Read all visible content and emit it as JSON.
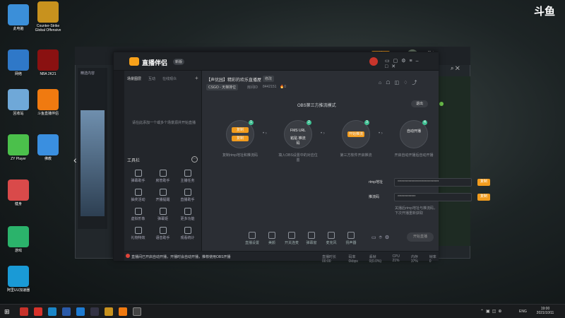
{
  "watermark": "斗鱼",
  "desktop": {
    "icons": [
      {
        "label": "此电脑",
        "color": "#3b8fd9"
      },
      {
        "label": "Counter-Strike Global Offensive",
        "color": "#c8921e"
      },
      {
        "label": "网络",
        "color": "#2f78c8"
      },
      {
        "label": "NBA 2K21",
        "color": "#8a1111"
      },
      {
        "label": "回收站",
        "color": "#6fa8d8"
      },
      {
        "label": "斗鱼直播伴侣",
        "color": "#f07a10"
      },
      {
        "label": "ZY Player",
        "color": "#4bc04b"
      },
      {
        "label": "佛教",
        "color": "#3a8fe0"
      },
      {
        "label": "健身",
        "color": "#d94a4a"
      },
      {
        "label": "游戏",
        "color": "#2bb36b"
      },
      {
        "label": "阿里UU加速器",
        "color": "#1a9ad6"
      }
    ]
  },
  "back_window": {
    "tabs": [
      "大厅",
      "数据",
      "商城",
      "直播",
      "大行动",
      "•••"
    ],
    "sidebar_text": "精选内容",
    "badge": "新"
  },
  "app": {
    "title": "直播伴侣",
    "version_badge": "新版",
    "left_tabs": [
      "场景图层",
      "互动",
      "在线观众"
    ],
    "empty_hint": "请在此添加一个或多个场景源并开始直播",
    "tools_title": "工具栏",
    "tools": [
      {
        "label": "弹幕助手",
        "icon": "barrage-icon"
      },
      {
        "label": "房管助手",
        "icon": "admin-icon"
      },
      {
        "label": "主播任务",
        "icon": "task-icon"
      },
      {
        "label": "抽奖活动",
        "icon": "lottery-icon"
      },
      {
        "label": "开播提醒",
        "icon": "download-icon"
      },
      {
        "label": "直播助手",
        "icon": "assistant-icon"
      },
      {
        "label": "虚拟形象",
        "icon": "avatar-icon"
      },
      {
        "label": "弹幕姬",
        "icon": "danmaku-icon"
      },
      {
        "label": "更多功能",
        "icon": "more-icon"
      },
      {
        "label": "礼物特效",
        "icon": "gift-icon"
      },
      {
        "label": "语音助手",
        "icon": "voice-icon"
      },
      {
        "label": "观看统计",
        "icon": "stats-icon"
      }
    ],
    "room_title": "【声优园】精彩的欢乐直播屋",
    "room_badge": "修改",
    "category": "CSGO - 天梯排位",
    "room_id_label": "房间ID",
    "room_id": "8442151",
    "hot": "0",
    "obs_mode_title": "OBS第三方推流模式",
    "exit_label": "退出",
    "steps": [
      {
        "num": "1",
        "btn1": "复制",
        "btn2": "复制",
        "caption": "复制rtmp地址和推流码"
      },
      {
        "num": "2",
        "top": "FMS URL",
        "bottom": "粘贴 推流码",
        "caption": "填入OBS设置中的对应位置"
      },
      {
        "num": "3",
        "btn": "开始推流",
        "caption": "第三方软件开启推流"
      },
      {
        "num": "4",
        "top": "自动开播",
        "caption": "开启自动开播后自动开播"
      }
    ],
    "rtmp_label": "rtmp地址",
    "rtmp_value": "******************************",
    "rtmp_copy": "复制",
    "key_label": "推流码",
    "key_value": "*************",
    "key_copy": "复制",
    "hint": "关播后rtmp地址与推流码，下次开播重新获取",
    "bottom_tools": [
      "直播设置",
      "美颜",
      "开关连麦",
      "弹幕窗",
      "麦克风",
      "扬声器"
    ],
    "start_button": "开始直播",
    "status_notice": "直播间已开启自动开播，开播时会自动开播，推荐使用OBS开播",
    "status_items": [
      "直播时长 00:00",
      "码率 0kbps",
      "丢帧 0(0.0%)",
      "CPU 21%",
      "内存 37%",
      "帧率 0"
    ]
  },
  "taskbar": {
    "lang": "ENG",
    "time": "19:00",
    "date": "2021/10/11"
  }
}
